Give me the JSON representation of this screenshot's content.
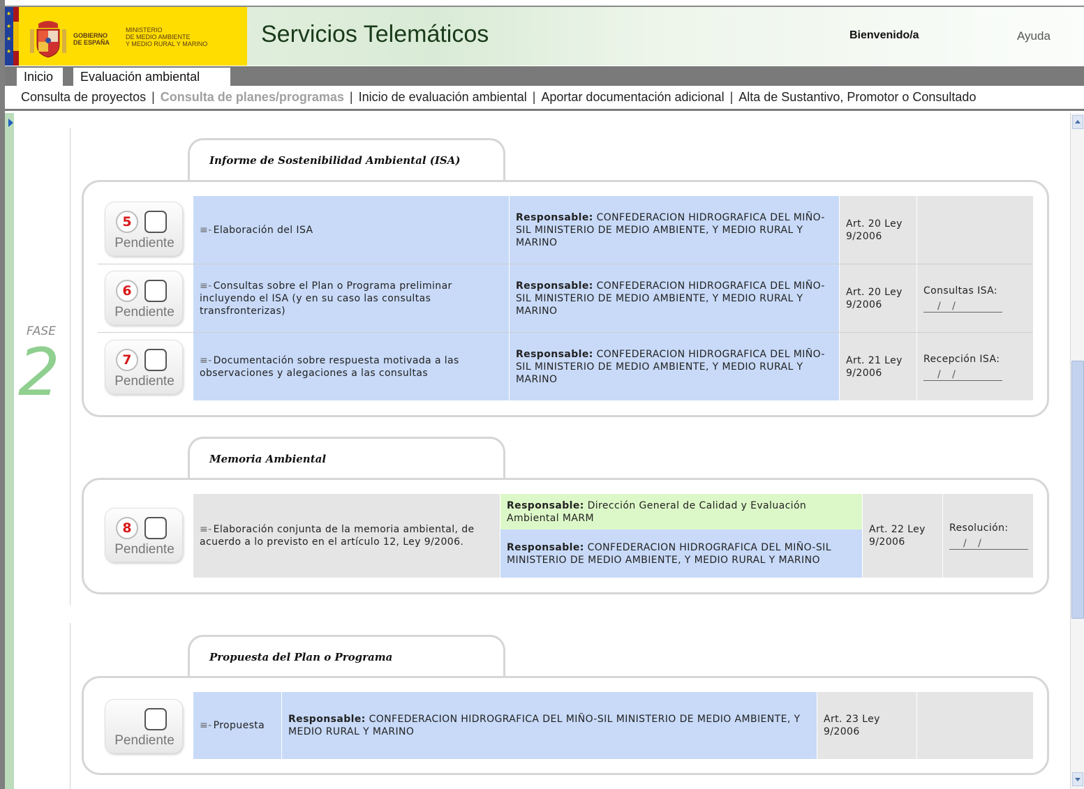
{
  "header": {
    "gobierno": "GOBIERNO\nDE ESPAÑA",
    "ministerio": "MINISTERIO\nDE MEDIO AMBIENTE\nY MEDIO RURAL Y MARINO",
    "app_title": "Servicios Telemáticos",
    "welcome": "Bienvenido/a",
    "help": "Ayuda"
  },
  "nav": {
    "tabs": [
      {
        "label": "Inicio"
      },
      {
        "label": "Evaluación ambiental"
      }
    ],
    "sub": [
      {
        "label": "Consulta de proyectos"
      },
      {
        "label": "Consulta de planes/programas"
      },
      {
        "label": "Inicio de evaluación ambiental"
      },
      {
        "label": "Aportar documentación adicional"
      },
      {
        "label": "Alta de Sustantivo, Promotor o Consultado"
      }
    ],
    "separator": "|"
  },
  "phase": {
    "label": "FASE",
    "number": "2"
  },
  "sections": [
    {
      "title": "Informe de Sostenibilidad Ambiental (ISA)",
      "rows": [
        {
          "num": "5",
          "status": "Pendiente",
          "task": "Elaboración del ISA",
          "resp_label": "Responsable:",
          "resp": "CONFEDERACION HIDROGRAFICA DEL MIÑO-SIL MINISTERIO DE MEDIO AMBIENTE, Y MEDIO RURAL Y MARINO",
          "art": "Art. 20 Ley 9/2006",
          "date_label": "",
          "date": ""
        },
        {
          "num": "6",
          "status": "Pendiente",
          "task": "Consultas sobre el Plan o Programa preliminar incluyendo el ISA (y en su caso las consultas transfronterizas)",
          "resp_label": "Responsable:",
          "resp": "CONFEDERACION HIDROGRAFICA DEL MIÑO-SIL MINISTERIO DE MEDIO AMBIENTE, Y MEDIO RURAL Y MARINO",
          "art": "Art. 20 Ley 9/2006",
          "date_label": "Consultas ISA:",
          "date": "/ /"
        },
        {
          "num": "7",
          "status": "Pendiente",
          "task": "Documentación sobre respuesta motivada a las observaciones y alegaciones a las consultas",
          "resp_label": "Responsable:",
          "resp": "CONFEDERACION HIDROGRAFICA DEL MIÑO-SIL MINISTERIO DE MEDIO AMBIENTE, Y MEDIO RURAL Y MARINO",
          "art": "Art. 21 Ley 9/2006",
          "date_label": "Recepción ISA:",
          "date": "/ /"
        }
      ]
    },
    {
      "title": "Memoria Ambiental",
      "rows": [
        {
          "num": "8",
          "status": "Pendiente",
          "task": "Elaboración conjunta de la memoria ambiental, de acuerdo a lo previsto en el artículo 12, Ley 9/2006.",
          "resp_label": "Responsable:",
          "resp_a": "Dirección General de Calidad y Evaluación Ambiental MARM",
          "resp_b": "CONFEDERACION HIDROGRAFICA DEL MIÑO-SIL MINISTERIO DE MEDIO AMBIENTE, Y MEDIO RURAL Y MARINO",
          "art": "Art. 22 Ley 9/2006",
          "date_label": "Resolución:",
          "date": "/ /"
        }
      ]
    },
    {
      "title": "Propuesta del Plan o Programa",
      "rows": [
        {
          "num": "",
          "status": "Pendiente",
          "task": "Propuesta",
          "resp_label": "Responsable:",
          "resp": "CONFEDERACION HIDROGRAFICA DEL MIÑO-SIL MINISTERIO DE MEDIO AMBIENTE, Y MEDIO RURAL Y MARINO",
          "art": "Art. 23 Ley 9/2006",
          "date_label": "",
          "date": ""
        }
      ]
    }
  ],
  "task_prefix": "≡-",
  "colors": {
    "blue_cell": "#c8daf8",
    "gray_cell": "#e5e5e5",
    "green_cell": "#ddf8c8",
    "header_yellow": "#ffdd00",
    "phase_green": "#8fcf8f",
    "step_number_red": "#d81a1a"
  }
}
